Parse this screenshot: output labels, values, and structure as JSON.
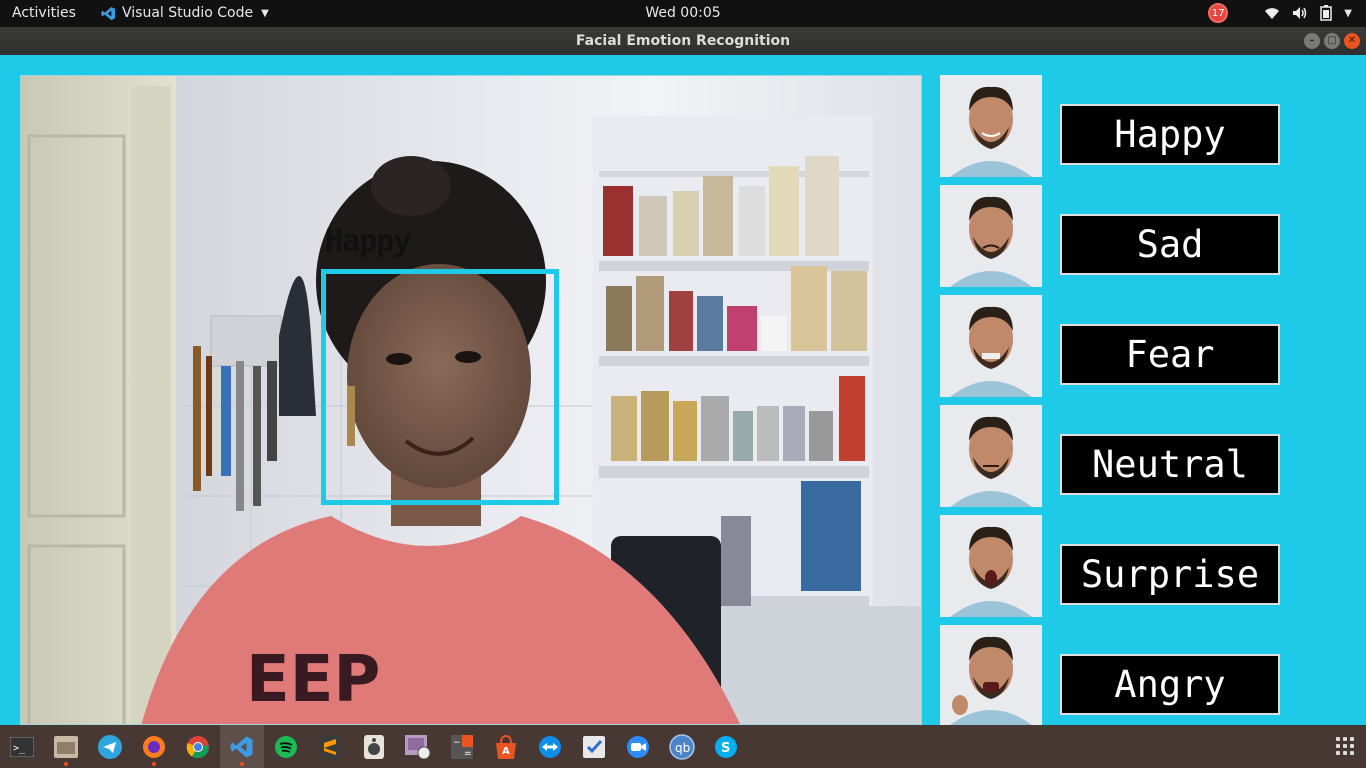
{
  "topbar": {
    "activities": "Activities",
    "app_name": "Visual Studio Code",
    "clock": "Wed 00:05",
    "notification_count": "17"
  },
  "window": {
    "title": "Facial Emotion Recognition"
  },
  "camera": {
    "detected_label": "Happy",
    "shirt_text": "EEP"
  },
  "emotions": [
    {
      "label": "Happy"
    },
    {
      "label": "Sad"
    },
    {
      "label": "Fear"
    },
    {
      "label": "Neutral"
    },
    {
      "label": "Surprise"
    },
    {
      "label": "Angry"
    }
  ],
  "dock": {
    "items": [
      {
        "name": "terminal-icon"
      },
      {
        "name": "files-icon"
      },
      {
        "name": "telegram-icon"
      },
      {
        "name": "firefox-icon"
      },
      {
        "name": "chrome-icon"
      },
      {
        "name": "vscode-icon"
      },
      {
        "name": "spotify-icon"
      },
      {
        "name": "sublime-text-icon"
      },
      {
        "name": "speaker-icon"
      },
      {
        "name": "image-viewer-icon"
      },
      {
        "name": "calculator-icon"
      },
      {
        "name": "software-center-icon"
      },
      {
        "name": "teamviewer-icon"
      },
      {
        "name": "todo-icon"
      },
      {
        "name": "zoom-icon"
      },
      {
        "name": "qbittorrent-icon",
        "text": "qb"
      },
      {
        "name": "skype-icon",
        "text": "S"
      }
    ]
  },
  "colors": {
    "accent": "#1fc9e8",
    "topbar": "#111111",
    "dock": "#473833",
    "button_bg": "#000000",
    "ubuntu_orange": "#e95420"
  }
}
